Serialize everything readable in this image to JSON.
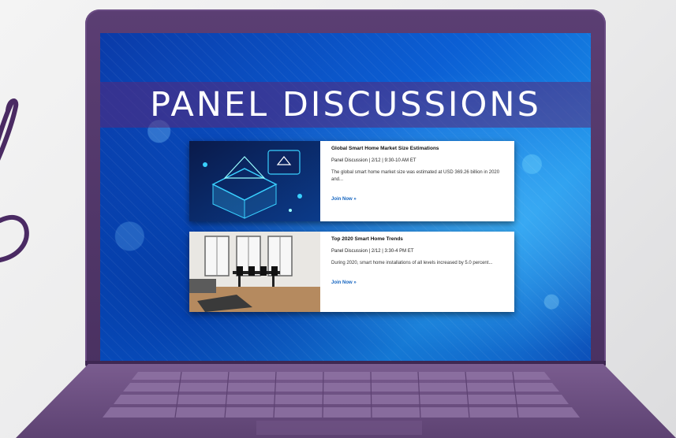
{
  "banner": {
    "title": "PANEL DISCUSSIONS"
  },
  "events": [
    {
      "title": "Global Smart Home Market Size Estimations",
      "meta": "Panel Discussion | 2/12 | 9:30-10 AM ET",
      "description": "The global smart home market size was estimated at USD 369.26 billion in 2020 and...",
      "link": "Join Now »"
    },
    {
      "title": "Top 2020 Smart Home Trends",
      "meta": "Panel Discussion | 2/12 |  3:30-4 PM ET",
      "description": "During 2020, smart home installations of all levels increased by 5.0 percent...",
      "link": "Join Now »"
    }
  ],
  "colors": {
    "laptop": "#4a3161",
    "banner_overlay": "#5a2878",
    "link": "#1565c0",
    "screen_bg": "#0b5fd4"
  }
}
